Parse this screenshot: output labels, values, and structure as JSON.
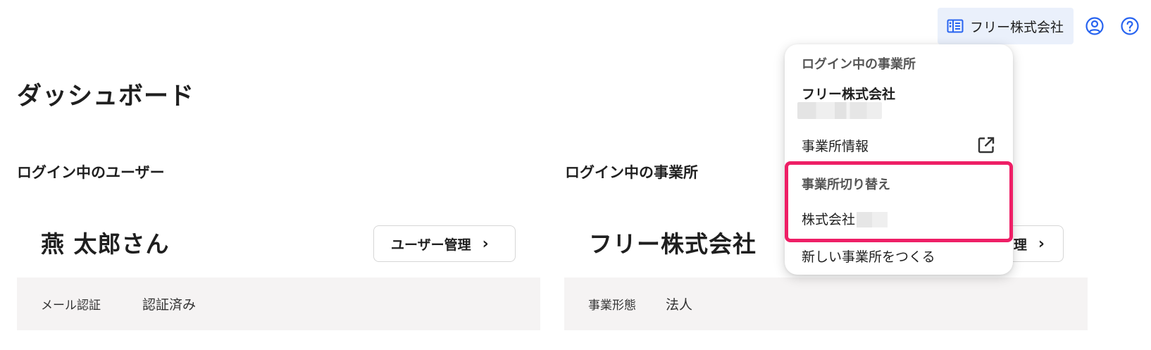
{
  "header": {
    "office_button_label": "フリー株式会社",
    "office_icon": "building-icon",
    "account_icon": "account-circle-icon",
    "help_icon": "help-circle-icon"
  },
  "page": {
    "title": "ダッシュボード"
  },
  "user_section": {
    "heading": "ログイン中のユーザー",
    "name": "燕 太郎さん",
    "manage_button": "ユーザー管理",
    "info_label": "メール認証",
    "info_value": "認証済み"
  },
  "office_section": {
    "heading": "ログイン中の事業所",
    "name": "フリー株式会社",
    "manage_button": "理",
    "info_label": "事業形態",
    "info_value": "法人"
  },
  "dropdown": {
    "current_title": "ログイン中の事業所",
    "current_name": "フリー株式会社",
    "office_info": "事業所情報",
    "external_icon": "open-in-new-icon",
    "switch_title": "事業所切り替え",
    "switch_item": "株式会社",
    "create_new": "新しい事業所をつくる"
  },
  "colors": {
    "accent_bg": "#eaf0fb",
    "icon_blue": "#2864f0",
    "highlight": "#ee1f66"
  }
}
